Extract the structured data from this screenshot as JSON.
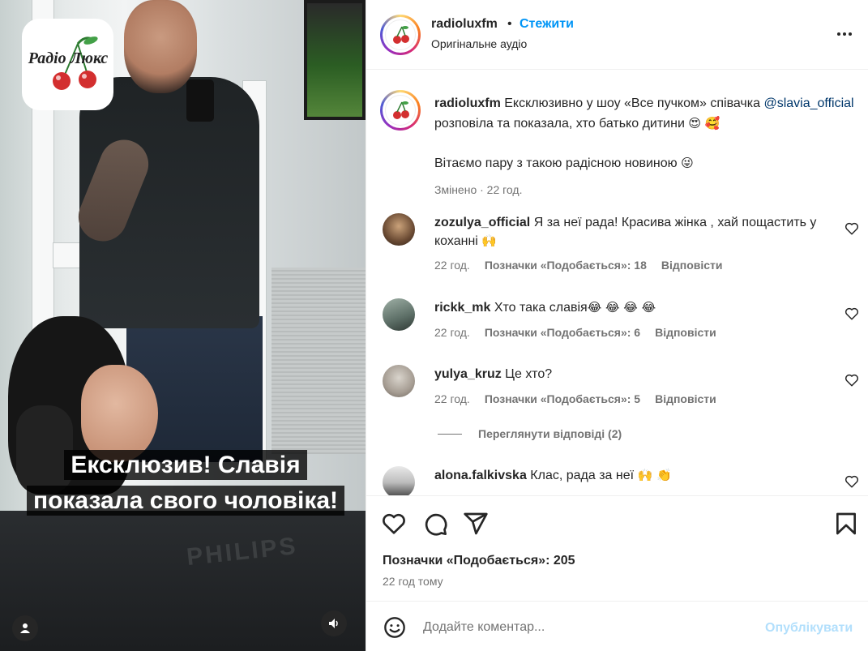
{
  "media": {
    "logo_text": "Радіо Люкс",
    "caption_line1": "Ексклюзив! Славія",
    "caption_line2": "показала свого чоловіка!",
    "monitor_brand": "PHILIPS",
    "user_icon": "user-icon",
    "sound_icon": "volume-icon"
  },
  "header": {
    "username": "radioluxfm",
    "separator": "•",
    "follow_label": "Стежити",
    "subtitle": "Оригінальне аудіо",
    "more_icon": "more-options-icon"
  },
  "caption": {
    "username": "radioluxfm",
    "text_part1": " Ексклюзивно у шоу «Все пучком» співачка ",
    "mention": "@slavia_official",
    "text_part2": " розповіла та показала, хто батько дитини ",
    "emojis1": "😍 🥰",
    "line2": "Вітаємо пару з такою радісною новиною ",
    "emojis2": "😜",
    "meta": "Змінено · 22 год."
  },
  "comments": [
    {
      "username": "zozulya_official",
      "text": " Я за неї рада! Красива жінка , хай пощастить у коханні ",
      "emoji": "🙌",
      "time": "22 год.",
      "likes": "Позначки «Подобається»: 18",
      "reply": "Відповісти"
    },
    {
      "username": "rickk_mk",
      "text": " Хто така славія",
      "emoji": "😂 😂 😂 😂",
      "time": "22 год.",
      "likes": "Позначки «Подобається»: 6",
      "reply": "Відповісти"
    },
    {
      "username": "yulya_kruz",
      "text": " Це хто?",
      "emoji": "",
      "time": "22 год.",
      "likes": "Позначки «Подобається»: 5",
      "reply": "Відповісти"
    },
    {
      "username": "alona.falkivska",
      "text": " Клас, рада за неї ",
      "emoji": "🙌 👏",
      "time": "",
      "likes": "",
      "reply": ""
    }
  ],
  "view_replies": "Переглянути відповіді (2)",
  "actions": {
    "like_icon": "heart-icon",
    "comment_icon": "comment-icon",
    "share_icon": "send-icon",
    "save_icon": "bookmark-icon",
    "likes_text": "Позначки «Подобається»: 205",
    "time_ago": "22 год тому"
  },
  "composer": {
    "placeholder": "Додайте коментар...",
    "publish_label": "Опублікувати",
    "emoji_icon": "smiley-icon"
  },
  "colors": {
    "accent": "#0095f6",
    "mention": "#00376b",
    "muted": "#737373",
    "publish_disabled": "#b2dffc"
  }
}
